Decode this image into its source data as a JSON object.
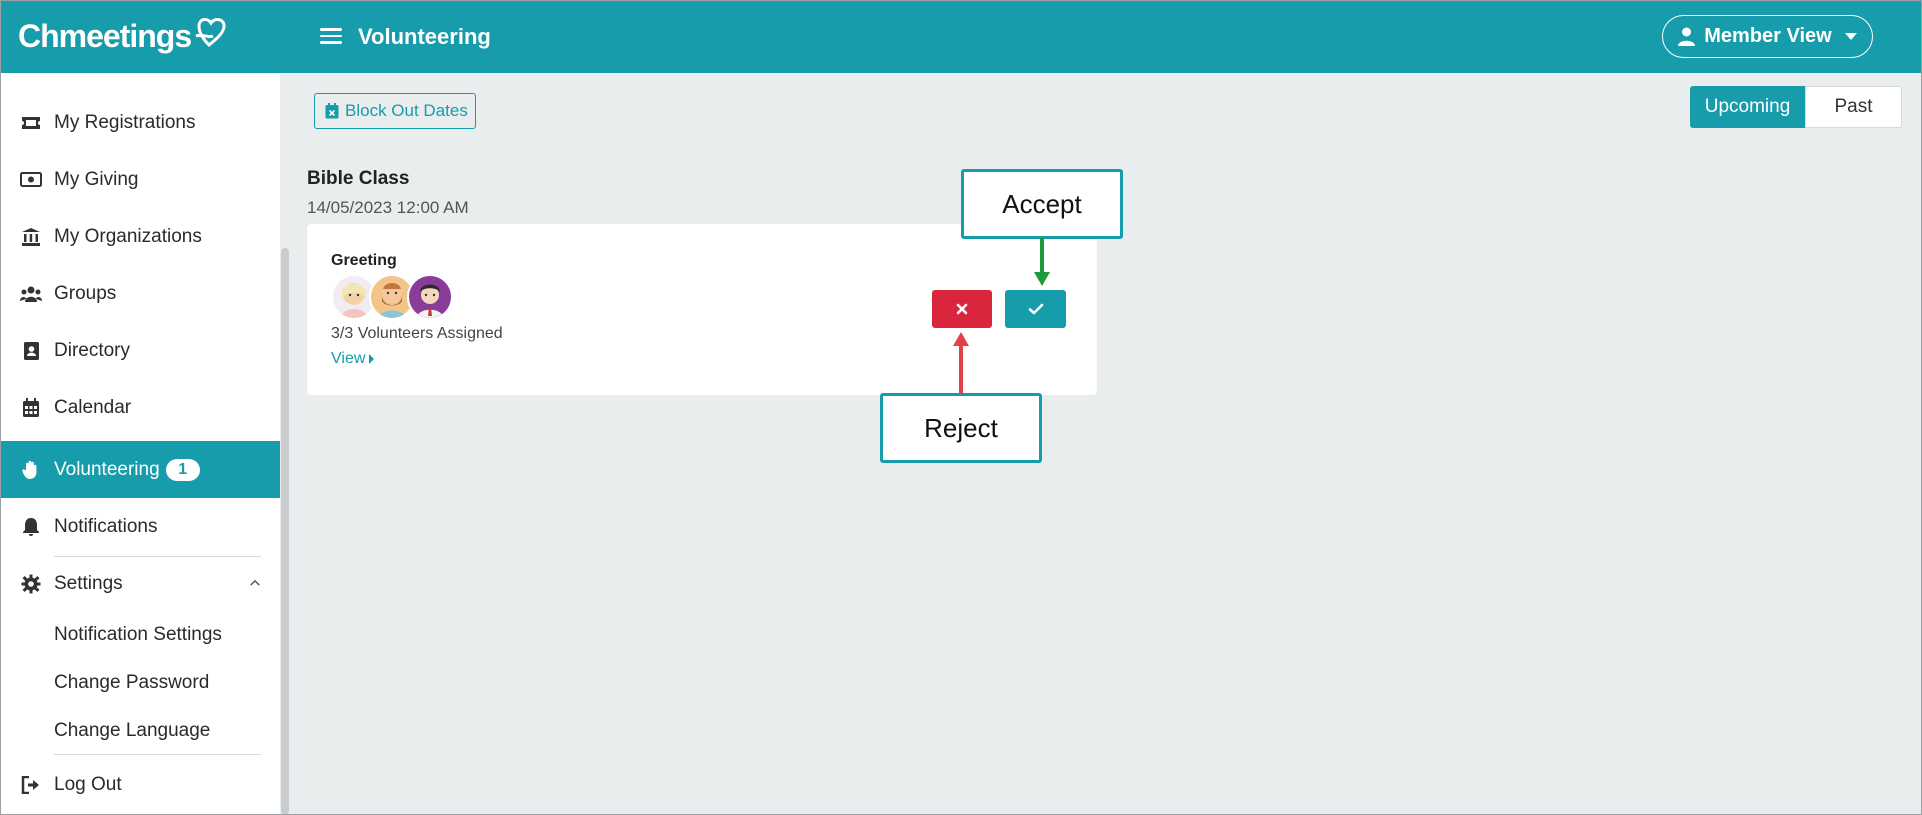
{
  "header": {
    "logo_text": "Chmeetings",
    "title": "Volunteering",
    "member_view_label": "Member View"
  },
  "sidebar": {
    "items": [
      {
        "label": "My Registrations",
        "icon": "ticket-icon"
      },
      {
        "label": "My Giving",
        "icon": "money-icon"
      },
      {
        "label": "My Organizations",
        "icon": "bank-icon"
      },
      {
        "label": "Groups",
        "icon": "users-icon"
      },
      {
        "label": "Directory",
        "icon": "address-book-icon"
      },
      {
        "label": "Calendar",
        "icon": "calendar-icon"
      },
      {
        "label": "Volunteering",
        "icon": "hand-icon",
        "badge": "1",
        "active": true
      },
      {
        "label": "Notifications",
        "icon": "bell-icon"
      },
      {
        "label": "Settings",
        "icon": "gear-icon"
      }
    ],
    "settings_subitems": [
      "Notification Settings",
      "Change Password",
      "Change Language"
    ],
    "logout_label": "Log Out"
  },
  "toolbar": {
    "block_out_label": "Block Out Dates",
    "tabs": [
      "Upcoming",
      "Past"
    ],
    "active_tab": "Upcoming"
  },
  "event": {
    "title": "Bible Class",
    "date": "14/05/2023 12:00 AM",
    "role": "Greeting",
    "assigned": "3/3 Volunteers Assigned",
    "view_label": "View"
  },
  "annotations": {
    "accept": "Accept",
    "reject": "Reject"
  },
  "colors": {
    "brand": "#169caa",
    "reject": "#d9263c",
    "accept_arrow": "#1f9a3a",
    "reject_arrow": "#e0424b"
  }
}
